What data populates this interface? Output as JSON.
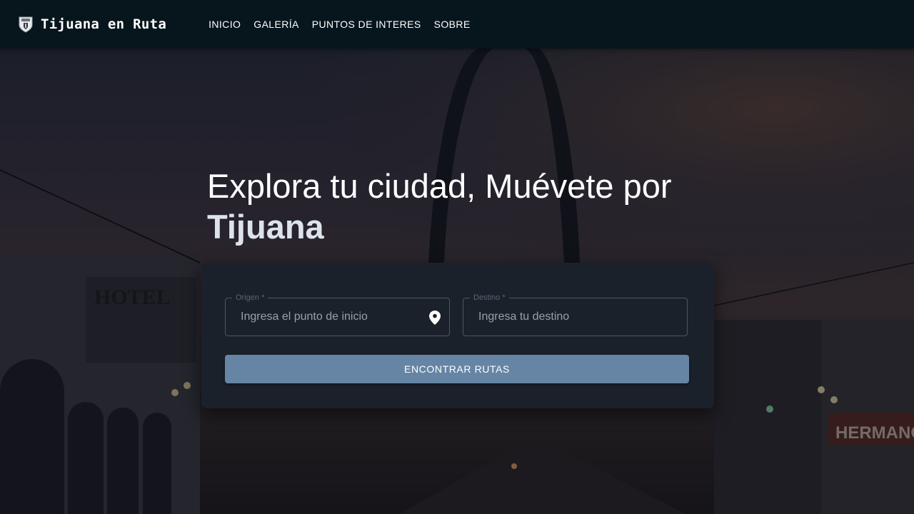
{
  "nav": {
    "brand": "Tijuana en Ruta",
    "logo_icon": "shield-crest-icon",
    "links": [
      "INICIO",
      "GALERÍA",
      "PUNTOS DE INTERES",
      "SOBRE"
    ]
  },
  "hero": {
    "title_line1": "Explora tu ciudad, Muévete por",
    "title_line2": "Tijuana",
    "background_sign": "HOTEL",
    "background_sign2": "HERMANOS"
  },
  "search": {
    "origin_label": "Origen *",
    "origin_placeholder": "Ingresa el punto de inicio",
    "origin_icon": "map-pin-icon",
    "destination_label": "Destino *",
    "destination_placeholder": "Ingresa tu destino",
    "submit_label": "ENCONTRAR RUTAS"
  },
  "colors": {
    "navbar": "#07161d",
    "card": "#1b212b",
    "button": "#6685a5"
  }
}
